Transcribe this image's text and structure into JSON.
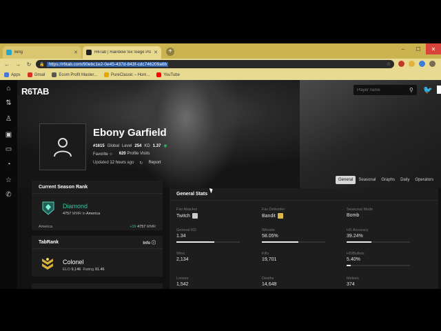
{
  "browser": {
    "tabs": [
      {
        "label": "Bing",
        "favicon_color": "#2aa6c9",
        "close": "✕"
      },
      {
        "label": "R6Tab | Rainbow Six Siege Player",
        "favicon_color": "#222222",
        "close": "✕"
      }
    ],
    "new_tab": "+",
    "url": "https://r6tab.com/90ebc1e2-0e45-437d-843f-cdc746209a6b",
    "bookmarks": [
      {
        "label": "Apps",
        "color": "#4a79d8"
      },
      {
        "label": "Gmail",
        "color": "#d93025"
      },
      {
        "label": "Ecom Profit Master...",
        "color": "#555555"
      },
      {
        "label": "PureClassic – Hom...",
        "color": "#e0a800"
      },
      {
        "label": "YouTube",
        "color": "#ff0000"
      }
    ]
  },
  "site": {
    "logo": "R6TAB",
    "search_placeholder": "Player name",
    "sidebar_icons": [
      "home-icon",
      "updown-icon",
      "user-icon",
      "calendar-icon",
      "video-icon",
      "chart-icon",
      "star-icon",
      "phone-icon"
    ]
  },
  "profile": {
    "name": "Ebony Garfield",
    "global_rank": "#1615",
    "global_label": "Global",
    "level_label": "Level",
    "level": "254",
    "kd_label": "KD",
    "kd": "1.37",
    "favorite": "Favorite",
    "profile_visits_count": "620",
    "profile_visits_label": "Profile Visits",
    "updated_prefix": "Updated",
    "updated_value": "12 hours",
    "updated_suffix": "ago",
    "report": "Report"
  },
  "tabs": [
    "General",
    "Seasonal",
    "Graphs",
    "Daily",
    "Operators"
  ],
  "current_season": {
    "title": "Current Season Rank",
    "rank": "Diamond",
    "mmr_value": "4757",
    "mmr_label": "MMR in",
    "region": "America",
    "footer_region": "America",
    "footer_change": "+39",
    "footer_mmr": "4757",
    "footer_mmr_label": "MMR"
  },
  "tabrank": {
    "title": "TabRank",
    "info": "Info",
    "rank": "Colonel",
    "elo_label": "ELO",
    "elo": "9,146",
    "rating_label": "Rating",
    "rating": "91.46"
  },
  "general_stats": {
    "title": "General Stats",
    "items": [
      {
        "label": "Fav Attacker",
        "value": "Twitch",
        "icon": "twitch-operator-icon"
      },
      {
        "label": "Fav Defender",
        "value": "Bandit",
        "icon": "bandit-operator-icon"
      },
      {
        "label": "Seasonal Mode",
        "value": "Bomb"
      },
      {
        "label": "General KD",
        "value": "1.34",
        "bar": 0.6
      },
      {
        "label": "Winrate",
        "value": "58.05%",
        "bar": 0.58
      },
      {
        "label": "HS Accuracy",
        "value": "39.24%",
        "bar": 0.39
      },
      {
        "label": "Wins",
        "value": "2,134"
      },
      {
        "label": "Kills",
        "value": "19,701"
      },
      {
        "label": "HS/Bullets",
        "value": "5.40%",
        "bar": 0.06
      },
      {
        "label": "Losses",
        "value": "1,542"
      },
      {
        "label": "Deaths",
        "value": "14,648"
      },
      {
        "label": "Melees",
        "value": "374"
      }
    ]
  }
}
